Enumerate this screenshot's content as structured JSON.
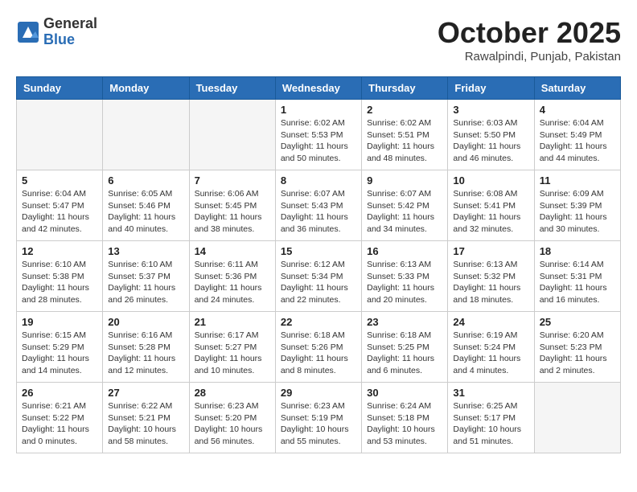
{
  "header": {
    "logo_general": "General",
    "logo_blue": "Blue",
    "month_title": "October 2025",
    "location": "Rawalpindi, Punjab, Pakistan"
  },
  "weekdays": [
    "Sunday",
    "Monday",
    "Tuesday",
    "Wednesday",
    "Thursday",
    "Friday",
    "Saturday"
  ],
  "weeks": [
    [
      {
        "day": "",
        "info": ""
      },
      {
        "day": "",
        "info": ""
      },
      {
        "day": "",
        "info": ""
      },
      {
        "day": "1",
        "info": "Sunrise: 6:02 AM\nSunset: 5:53 PM\nDaylight: 11 hours\nand 50 minutes."
      },
      {
        "day": "2",
        "info": "Sunrise: 6:02 AM\nSunset: 5:51 PM\nDaylight: 11 hours\nand 48 minutes."
      },
      {
        "day": "3",
        "info": "Sunrise: 6:03 AM\nSunset: 5:50 PM\nDaylight: 11 hours\nand 46 minutes."
      },
      {
        "day": "4",
        "info": "Sunrise: 6:04 AM\nSunset: 5:49 PM\nDaylight: 11 hours\nand 44 minutes."
      }
    ],
    [
      {
        "day": "5",
        "info": "Sunrise: 6:04 AM\nSunset: 5:47 PM\nDaylight: 11 hours\nand 42 minutes."
      },
      {
        "day": "6",
        "info": "Sunrise: 6:05 AM\nSunset: 5:46 PM\nDaylight: 11 hours\nand 40 minutes."
      },
      {
        "day": "7",
        "info": "Sunrise: 6:06 AM\nSunset: 5:45 PM\nDaylight: 11 hours\nand 38 minutes."
      },
      {
        "day": "8",
        "info": "Sunrise: 6:07 AM\nSunset: 5:43 PM\nDaylight: 11 hours\nand 36 minutes."
      },
      {
        "day": "9",
        "info": "Sunrise: 6:07 AM\nSunset: 5:42 PM\nDaylight: 11 hours\nand 34 minutes."
      },
      {
        "day": "10",
        "info": "Sunrise: 6:08 AM\nSunset: 5:41 PM\nDaylight: 11 hours\nand 32 minutes."
      },
      {
        "day": "11",
        "info": "Sunrise: 6:09 AM\nSunset: 5:39 PM\nDaylight: 11 hours\nand 30 minutes."
      }
    ],
    [
      {
        "day": "12",
        "info": "Sunrise: 6:10 AM\nSunset: 5:38 PM\nDaylight: 11 hours\nand 28 minutes."
      },
      {
        "day": "13",
        "info": "Sunrise: 6:10 AM\nSunset: 5:37 PM\nDaylight: 11 hours\nand 26 minutes."
      },
      {
        "day": "14",
        "info": "Sunrise: 6:11 AM\nSunset: 5:36 PM\nDaylight: 11 hours\nand 24 minutes."
      },
      {
        "day": "15",
        "info": "Sunrise: 6:12 AM\nSunset: 5:34 PM\nDaylight: 11 hours\nand 22 minutes."
      },
      {
        "day": "16",
        "info": "Sunrise: 6:13 AM\nSunset: 5:33 PM\nDaylight: 11 hours\nand 20 minutes."
      },
      {
        "day": "17",
        "info": "Sunrise: 6:13 AM\nSunset: 5:32 PM\nDaylight: 11 hours\nand 18 minutes."
      },
      {
        "day": "18",
        "info": "Sunrise: 6:14 AM\nSunset: 5:31 PM\nDaylight: 11 hours\nand 16 minutes."
      }
    ],
    [
      {
        "day": "19",
        "info": "Sunrise: 6:15 AM\nSunset: 5:29 PM\nDaylight: 11 hours\nand 14 minutes."
      },
      {
        "day": "20",
        "info": "Sunrise: 6:16 AM\nSunset: 5:28 PM\nDaylight: 11 hours\nand 12 minutes."
      },
      {
        "day": "21",
        "info": "Sunrise: 6:17 AM\nSunset: 5:27 PM\nDaylight: 11 hours\nand 10 minutes."
      },
      {
        "day": "22",
        "info": "Sunrise: 6:18 AM\nSunset: 5:26 PM\nDaylight: 11 hours\nand 8 minutes."
      },
      {
        "day": "23",
        "info": "Sunrise: 6:18 AM\nSunset: 5:25 PM\nDaylight: 11 hours\nand 6 minutes."
      },
      {
        "day": "24",
        "info": "Sunrise: 6:19 AM\nSunset: 5:24 PM\nDaylight: 11 hours\nand 4 minutes."
      },
      {
        "day": "25",
        "info": "Sunrise: 6:20 AM\nSunset: 5:23 PM\nDaylight: 11 hours\nand 2 minutes."
      }
    ],
    [
      {
        "day": "26",
        "info": "Sunrise: 6:21 AM\nSunset: 5:22 PM\nDaylight: 11 hours\nand 0 minutes."
      },
      {
        "day": "27",
        "info": "Sunrise: 6:22 AM\nSunset: 5:21 PM\nDaylight: 10 hours\nand 58 minutes."
      },
      {
        "day": "28",
        "info": "Sunrise: 6:23 AM\nSunset: 5:20 PM\nDaylight: 10 hours\nand 56 minutes."
      },
      {
        "day": "29",
        "info": "Sunrise: 6:23 AM\nSunset: 5:19 PM\nDaylight: 10 hours\nand 55 minutes."
      },
      {
        "day": "30",
        "info": "Sunrise: 6:24 AM\nSunset: 5:18 PM\nDaylight: 10 hours\nand 53 minutes."
      },
      {
        "day": "31",
        "info": "Sunrise: 6:25 AM\nSunset: 5:17 PM\nDaylight: 10 hours\nand 51 minutes."
      },
      {
        "day": "",
        "info": ""
      }
    ]
  ]
}
